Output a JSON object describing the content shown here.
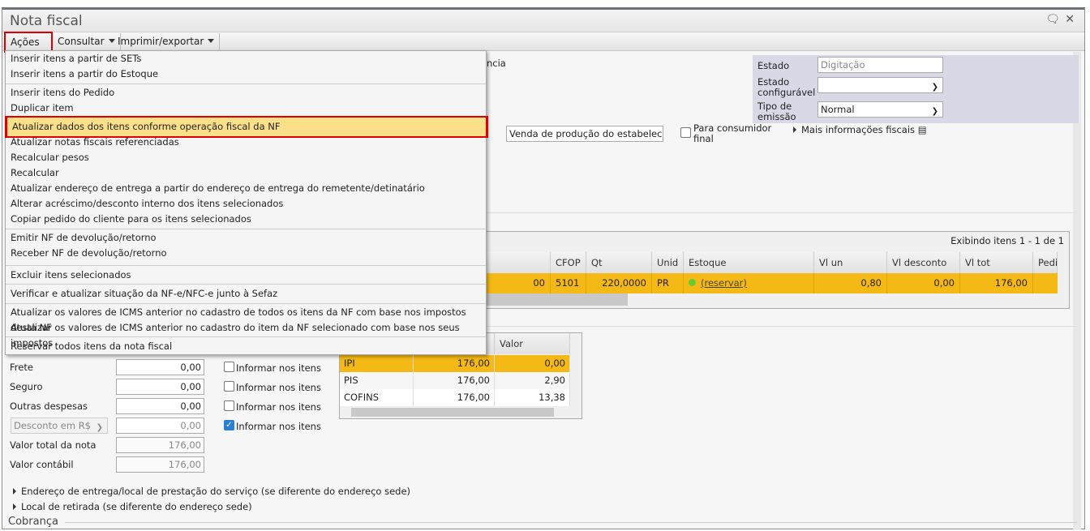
{
  "window": {
    "title": "Nota fiscal"
  },
  "toolbar": {
    "acoes": "Ações",
    "consultar": "Consultar",
    "imprimir": "Imprimir/exportar"
  },
  "menu": {
    "items": [
      "Inserir itens a partir de SETs",
      "Inserir itens a partir do Estoque",
      "Inserir itens do Pedido",
      "Duplicar item",
      "Atualizar dados dos itens conforme operação fiscal da NF",
      "Atualizar notas fiscais referenciadas",
      "Recalcular pesos",
      "Recalcular",
      "Atualizar endereço de entrega a partir do endereço de entrega do remetente/detinatário",
      "Alterar acréscimo/desconto interno dos itens selecionados",
      "Copiar pedido do cliente para os itens selecionados",
      "Emitir NF de devolução/retorno",
      "Receber NF de devolução/retorno",
      "Excluir itens selecionados",
      "Verificar e atualizar situação da NF-e/NFC-e junto à Sefaz",
      "Atualizar os valores de ICMS anterior no cadastro de todos os itens da NF com base nos impostos desta NF",
      "Atualizar os valores de ICMS anterior no cadastro do item da NF selecionado com base nos seus impostos",
      "Reservar todos itens da nota fiscal"
    ],
    "highlighted": "Atualizar dados dos itens conforme operação fiscal da NF"
  },
  "header": {
    "partial_label": "ncia",
    "estado_label": "Estado",
    "estado_value": "Digitação",
    "estado_conf_label": "Estado configurável",
    "estado_conf_value": "",
    "tipo_emissao_label": "Tipo de emissão",
    "tipo_emissao_value": "Normal",
    "operacao_value": "Venda de produção do estabelecime",
    "consumidor_final_label": "Para consumidor final",
    "consumidor_final_checked": false,
    "mais_info": "Mais informações fiscais"
  },
  "items_grid": {
    "paging": "Exibindo itens 1 - 1 de 1",
    "columns": [
      "CFOP",
      "Qt",
      "Unid",
      "Estoque",
      "Vl un",
      "Vl desconto",
      "Vl tot",
      "Pedi"
    ],
    "rows": [
      {
        "partial": "00",
        "cfop": "5101",
        "qt": "220,0000",
        "unid": "PR",
        "estoque": "(reservar)",
        "vl_un": "0,80",
        "vl_desconto": "0,00",
        "vl_tot": "176,00"
      }
    ]
  },
  "totals": {
    "frete_label": "Frete",
    "frete": "0,00",
    "seguro_label": "Seguro",
    "seguro": "0,00",
    "outras_label": "Outras despesas",
    "outras": "0,00",
    "desconto_select": "Desconto em R$",
    "desconto": "0,00",
    "total_label": "Valor total da nota",
    "total": "176,00",
    "contabil_label": "Valor contábil",
    "contabil": "176,00",
    "informar_label": "Informar nos itens",
    "informar_checked": [
      false,
      false,
      false,
      true
    ]
  },
  "tax_grid": {
    "valor_header": "Valor",
    "rows": [
      {
        "imposto": "IPI",
        "base": "176,00",
        "valor": "0,00"
      },
      {
        "imposto": "PIS",
        "base": "176,00",
        "valor": "2,90"
      },
      {
        "imposto": "COFINS",
        "base": "176,00",
        "valor": "13,38"
      }
    ]
  },
  "sections": {
    "endereco_entrega": "Endereço de entrega/local de prestação do serviço (se diferente do endereço sede)",
    "local_retirada": "Local de retirada (se diferente do endereço sede)",
    "cobranca": "Cobrança"
  },
  "colors": {
    "selected_row": "#f5b915",
    "menu_highlight": "#fbe08a",
    "annotation": "#e00000"
  }
}
